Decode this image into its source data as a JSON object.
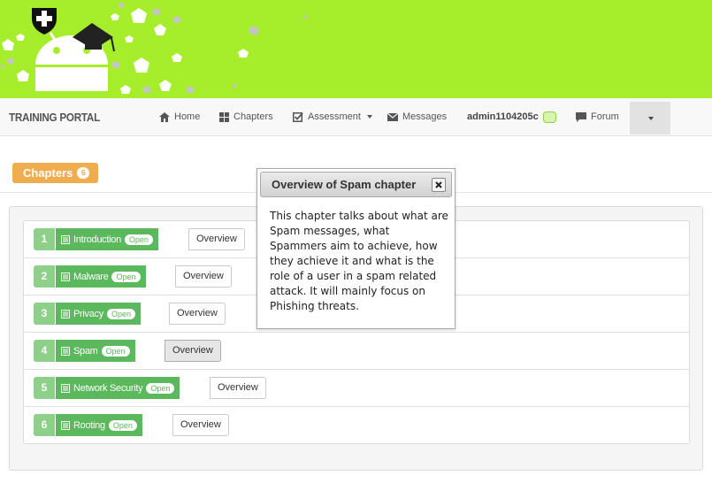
{
  "banner": {
    "background": "#a6ee2b",
    "logo_icon": "android-graduate-icon",
    "badge_icon": "shield-cross-icon"
  },
  "navbar": {
    "brand": "TRAINING PORTAL",
    "items": [
      {
        "label": "Home",
        "icon": "home-icon"
      },
      {
        "label": "Chapters",
        "icon": "grid-icon"
      },
      {
        "label": "Assessment",
        "icon": "checkbox-icon",
        "has_caret": true
      },
      {
        "label": "Messages",
        "icon": "envelope-icon"
      },
      {
        "label": "admin1104205c",
        "icon": "avatar-icon"
      },
      {
        "label": "Forum",
        "icon": "comment-icon"
      }
    ]
  },
  "chapters_header": {
    "title": "Chapters",
    "count": "6"
  },
  "chapters": [
    {
      "number": "1",
      "name": "Introduction",
      "status": "Open",
      "action": "Overview"
    },
    {
      "number": "2",
      "name": "Malware",
      "status": "Open",
      "action": "Overview"
    },
    {
      "number": "3",
      "name": "Privacy",
      "status": "Open",
      "action": "Overview"
    },
    {
      "number": "4",
      "name": "Spam",
      "status": "Open",
      "action": "Overview"
    },
    {
      "number": "5",
      "name": "Network Security",
      "status": "Open",
      "action": "Overview"
    },
    {
      "number": "6",
      "name": "Rooting",
      "status": "Open",
      "action": "Overview"
    }
  ],
  "popup": {
    "title": "Overview of Spam chapter",
    "body": "This chapter talks about what are Spam messages, what Spammers aim to achieve, how they achieve it and what is the role of a user in a spam related attack. It will mainly focus on Phishing threats."
  },
  "colors": {
    "green": "#5cb85c",
    "light_green": "#8ecf8a",
    "orange": "#f0ad4e"
  }
}
